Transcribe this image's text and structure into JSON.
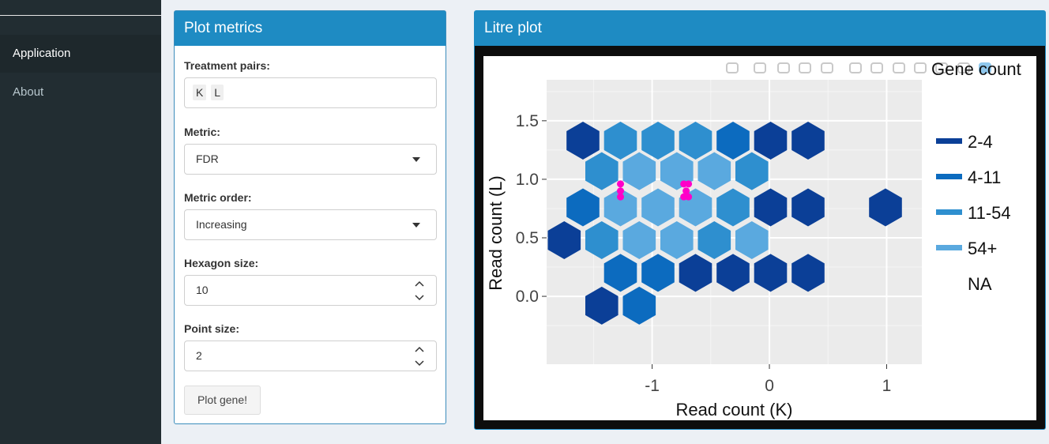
{
  "sidebar": {
    "items": [
      {
        "label": "Application",
        "active": true
      },
      {
        "label": "About",
        "active": false
      }
    ]
  },
  "metrics": {
    "title": "Plot metrics",
    "treatment_pairs": {
      "label": "Treatment pairs:",
      "tags": [
        "K",
        "L"
      ]
    },
    "metric": {
      "label": "Metric:",
      "value": "FDR"
    },
    "metric_order": {
      "label": "Metric order:",
      "value": "Increasing"
    },
    "hexagon_size": {
      "label": "Hexagon size:",
      "value": "10"
    },
    "point_size": {
      "label": "Point size:",
      "value": "2"
    },
    "button_label": "Plot gene!"
  },
  "plot": {
    "title": "Litre plot",
    "toolbar_icons": [
      "camera-icon",
      "zoom-icon",
      "pan-icon",
      "box-select-icon",
      "lasso-icon",
      "zoom-in-icon",
      "zoom-out-icon",
      "autoscale-icon",
      "home-icon",
      "spike-icon",
      "hover-icon",
      "plotly-logo-icon"
    ]
  },
  "chart_data": {
    "type": "hexbin",
    "xlabel": "Read count (K)",
    "ylabel": "Read count (L)",
    "xticks": [
      -1,
      0,
      1
    ],
    "yticks": [
      "0.0",
      "0.5",
      "1.0",
      "1.5"
    ],
    "xlim": [
      -1.9,
      1.3
    ],
    "ylim": [
      -0.58,
      1.85
    ],
    "grid": true,
    "legend": {
      "title": "Gene count",
      "position": "right",
      "entries": [
        {
          "label": "2-4",
          "color": "#0b3f97"
        },
        {
          "label": "4-11",
          "color": "#0c6bbf"
        },
        {
          "label": "11-54",
          "color": "#2e8fcf"
        },
        {
          "label": "54+",
          "color": "#5aa9df"
        },
        {
          "label": "NA",
          "color": "#ffffff"
        }
      ]
    },
    "hexagons": [
      {
        "x": -1.59,
        "y": 1.33,
        "bin": "2-4"
      },
      {
        "x": -1.27,
        "y": 1.33,
        "bin": "11-54"
      },
      {
        "x": -0.95,
        "y": 1.33,
        "bin": "11-54"
      },
      {
        "x": -0.63,
        "y": 1.33,
        "bin": "11-54"
      },
      {
        "x": -0.31,
        "y": 1.33,
        "bin": "4-11"
      },
      {
        "x": 0.01,
        "y": 1.33,
        "bin": "2-4"
      },
      {
        "x": 0.33,
        "y": 1.33,
        "bin": "2-4"
      },
      {
        "x": -1.43,
        "y": 1.07,
        "bin": "11-54"
      },
      {
        "x": -1.11,
        "y": 1.07,
        "bin": "54+"
      },
      {
        "x": -0.79,
        "y": 1.07,
        "bin": "54+"
      },
      {
        "x": -0.47,
        "y": 1.07,
        "bin": "54+"
      },
      {
        "x": -0.15,
        "y": 1.07,
        "bin": "11-54"
      },
      {
        "x": -1.59,
        "y": 0.76,
        "bin": "4-11"
      },
      {
        "x": -1.27,
        "y": 0.76,
        "bin": "54+"
      },
      {
        "x": -0.95,
        "y": 0.76,
        "bin": "54+"
      },
      {
        "x": -0.63,
        "y": 0.76,
        "bin": "54+"
      },
      {
        "x": -0.31,
        "y": 0.76,
        "bin": "11-54"
      },
      {
        "x": 0.01,
        "y": 0.76,
        "bin": "2-4"
      },
      {
        "x": 0.33,
        "y": 0.76,
        "bin": "2-4"
      },
      {
        "x": 0.99,
        "y": 0.76,
        "bin": "2-4"
      },
      {
        "x": -1.75,
        "y": 0.48,
        "bin": "2-4"
      },
      {
        "x": -1.43,
        "y": 0.48,
        "bin": "11-54"
      },
      {
        "x": -1.11,
        "y": 0.48,
        "bin": "54+"
      },
      {
        "x": -0.79,
        "y": 0.48,
        "bin": "54+"
      },
      {
        "x": -0.47,
        "y": 0.48,
        "bin": "11-54"
      },
      {
        "x": -0.15,
        "y": 0.48,
        "bin": "54+"
      },
      {
        "x": -1.27,
        "y": 0.2,
        "bin": "4-11"
      },
      {
        "x": -0.95,
        "y": 0.2,
        "bin": "4-11"
      },
      {
        "x": -0.63,
        "y": 0.2,
        "bin": "2-4"
      },
      {
        "x": -0.31,
        "y": 0.2,
        "bin": "2-4"
      },
      {
        "x": 0.01,
        "y": 0.2,
        "bin": "2-4"
      },
      {
        "x": 0.33,
        "y": 0.2,
        "bin": "2-4"
      },
      {
        "x": -1.43,
        "y": -0.08,
        "bin": "2-4"
      },
      {
        "x": -1.11,
        "y": -0.08,
        "bin": "4-11"
      }
    ],
    "points": [
      {
        "x": -1.27,
        "y": 0.96
      },
      {
        "x": -1.27,
        "y": 0.9
      },
      {
        "x": -1.27,
        "y": 0.85
      },
      {
        "x": -0.73,
        "y": 0.96
      },
      {
        "x": -0.69,
        "y": 0.96
      },
      {
        "x": -0.71,
        "y": 0.9
      },
      {
        "x": -0.73,
        "y": 0.85
      },
      {
        "x": -0.69,
        "y": 0.85
      }
    ],
    "point_color": "#ff00c8",
    "panel_bg": "#ebebeb"
  }
}
